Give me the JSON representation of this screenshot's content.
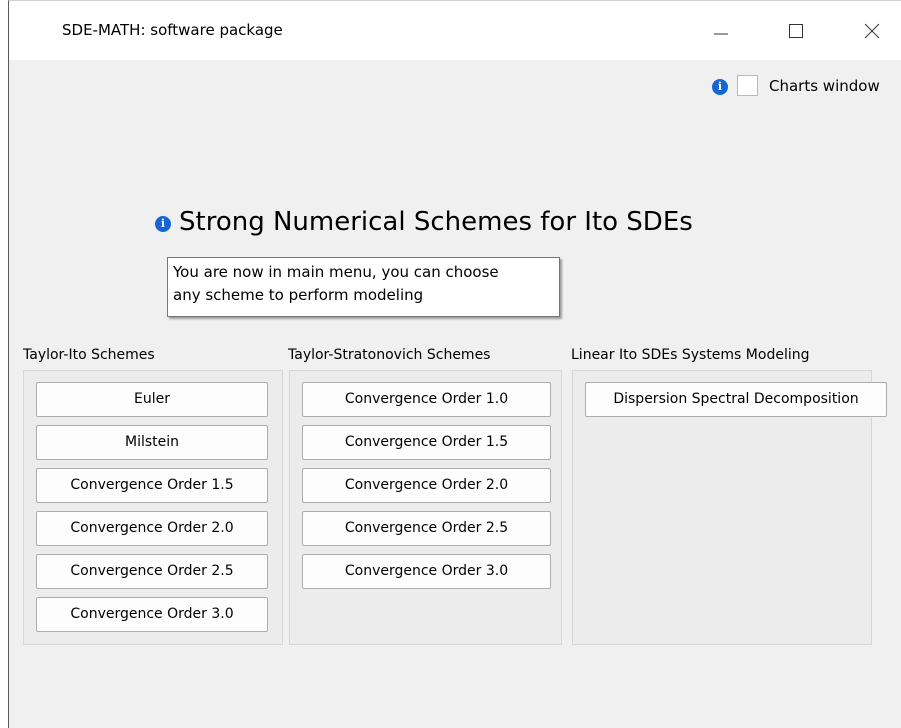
{
  "window": {
    "title": "SDE-MATH: software package"
  },
  "charts": {
    "label": "Charts window",
    "checked": false
  },
  "heading": "Strong Numerical Schemes for Ito SDEs",
  "tooltip": {
    "line1": "You are now in main menu, you can choose",
    "line2": "any scheme to perform modeling"
  },
  "groups": [
    {
      "title": "Taylor-Ito Schemes",
      "buttons": [
        "Euler",
        "Milstein",
        "Convergence Order 1.5",
        "Convergence Order 2.0",
        "Convergence Order 2.5",
        "Convergence Order 3.0"
      ]
    },
    {
      "title": "Taylor-Stratonovich Schemes",
      "buttons": [
        "Convergence Order 1.0",
        "Convergence Order 1.5",
        "Convergence Order 2.0",
        "Convergence Order 2.5",
        "Convergence Order 3.0"
      ]
    },
    {
      "title": "Linear Ito SDEs Systems Modeling",
      "buttons": [
        "Dispersion Spectral Decomposition"
      ]
    }
  ],
  "icons": {
    "info": "info-icon",
    "minimize": "minimize-icon",
    "maximize": "maximize-icon",
    "close": "close-icon"
  },
  "colors": {
    "accent": "#1565d8"
  }
}
